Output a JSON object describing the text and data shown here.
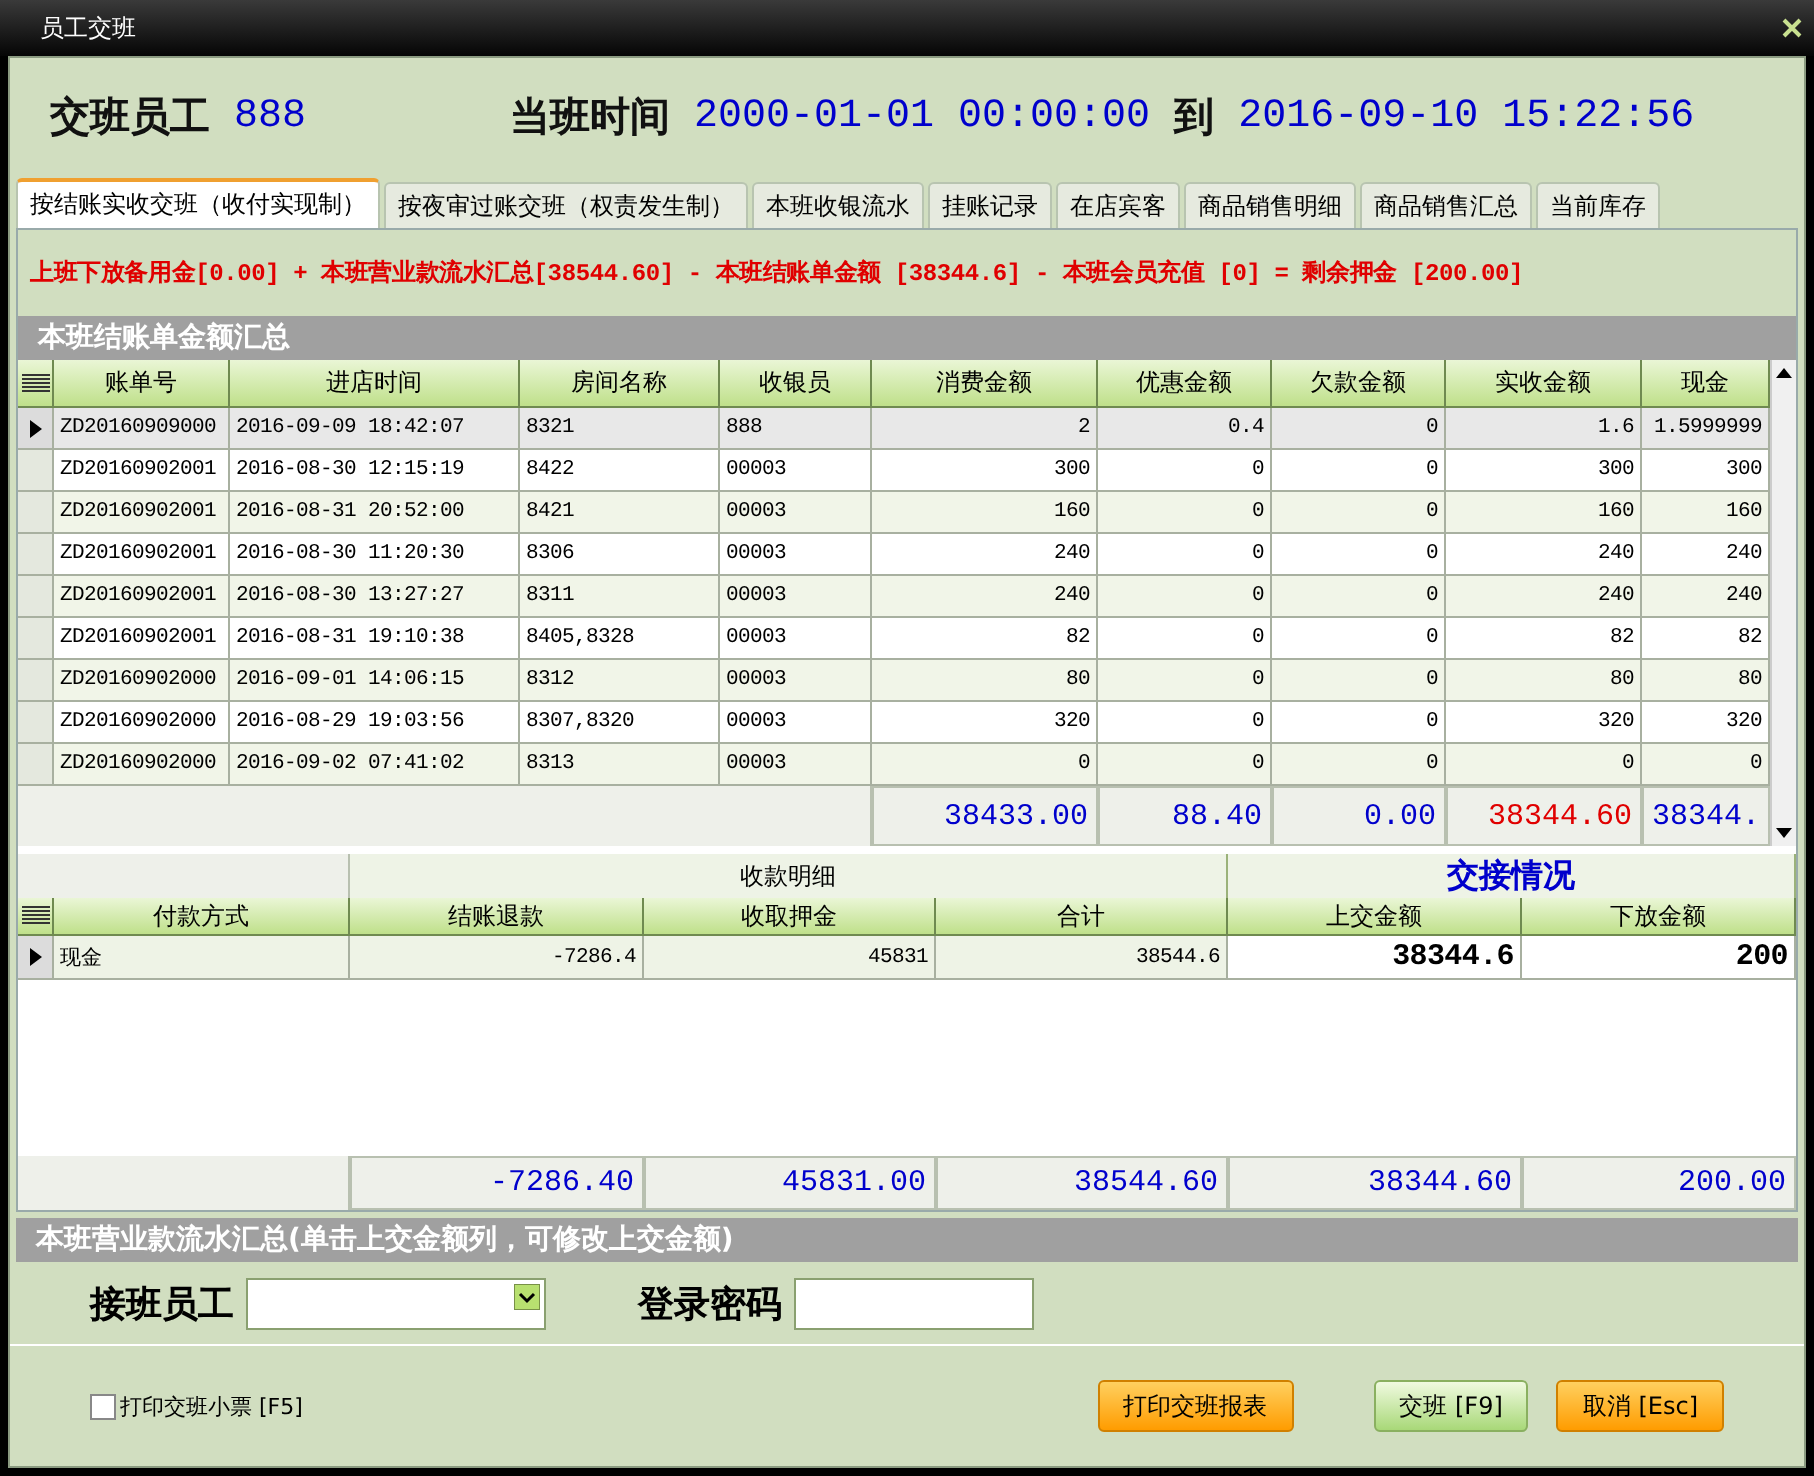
{
  "window": {
    "title": "员工交班"
  },
  "header": {
    "employee_label": "交班员工",
    "employee": "888",
    "shift_label": "当班时间",
    "start": "2000-01-01 00:00:00",
    "to": "到",
    "end": "2016-09-10 15:22:56"
  },
  "tabs": [
    {
      "label": "按结账实收交班（收付实现制）",
      "selected": true
    },
    {
      "label": "按夜审过账交班（权责发生制）",
      "selected": false
    },
    {
      "label": "本班收银流水",
      "selected": false
    },
    {
      "label": "挂账记录",
      "selected": false
    },
    {
      "label": "在店宾客",
      "selected": false
    },
    {
      "label": "商品销售明细",
      "selected": false
    },
    {
      "label": "商品销售汇总",
      "selected": false
    },
    {
      "label": "当前库存",
      "selected": false
    }
  ],
  "formula": "上班下放备用金[0.00] + 本班营业款流水汇总[38544.60] - 本班结账单金额 [38344.6] - 本班会员充值 [0] = 剩余押金 [200.00]",
  "bills": {
    "title": "本班结账单金额汇总",
    "columns": [
      "账单号",
      "进店时间",
      "房间名称",
      "收银员",
      "消费金额",
      "优惠金额",
      "欠款金额",
      "实收金额",
      "现金"
    ],
    "rows": [
      {
        "selected": true,
        "cells": [
          "ZD20160909000",
          "2016-09-09 18:42:07",
          "8321",
          "888",
          "2",
          "0.4",
          "0",
          "1.6",
          "1.5999999"
        ]
      },
      {
        "selected": false,
        "cells": [
          "ZD20160902001",
          "2016-08-30 12:15:19",
          "8422",
          "00003",
          "300",
          "0",
          "0",
          "300",
          "300"
        ]
      },
      {
        "selected": false,
        "cells": [
          "ZD20160902001",
          "2016-08-31 20:52:00",
          "8421",
          "00003",
          "160",
          "0",
          "0",
          "160",
          "160"
        ]
      },
      {
        "selected": false,
        "cells": [
          "ZD20160902001",
          "2016-08-30 11:20:30",
          "8306",
          "00003",
          "240",
          "0",
          "0",
          "240",
          "240"
        ]
      },
      {
        "selected": false,
        "cells": [
          "ZD20160902001",
          "2016-08-30 13:27:27",
          "8311",
          "00003",
          "240",
          "0",
          "0",
          "240",
          "240"
        ]
      },
      {
        "selected": false,
        "cells": [
          "ZD20160902001",
          "2016-08-31 19:10:38",
          "8405,8328",
          "00003",
          "82",
          "0",
          "0",
          "82",
          "82"
        ]
      },
      {
        "selected": false,
        "cells": [
          "ZD20160902000",
          "2016-09-01 14:06:15",
          "8312",
          "00003",
          "80",
          "0",
          "0",
          "80",
          "80"
        ]
      },
      {
        "selected": false,
        "cells": [
          "ZD20160902000",
          "2016-08-29 19:03:56",
          "8307,8320",
          "00003",
          "320",
          "0",
          "0",
          "320",
          "320"
        ]
      },
      {
        "selected": false,
        "cells": [
          "ZD20160902000",
          "2016-09-02 07:41:02",
          "8313",
          "00003",
          "0",
          "0",
          "0",
          "0",
          "0"
        ]
      }
    ],
    "totals": [
      {
        "text": "38433.00",
        "color": "#0000cc"
      },
      {
        "text": "88.40",
        "color": "#0000cc"
      },
      {
        "text": "0.00",
        "color": "#0000cc"
      },
      {
        "text": "38344.60",
        "color": "#e00000"
      },
      {
        "text": "38344.",
        "color": "#0000cc"
      }
    ]
  },
  "payments": {
    "groups": [
      {
        "columns": [
          "付款方式"
        ]
      },
      {
        "label": "收款明细",
        "columns": [
          "结账退款",
          "收取押金",
          "合计"
        ],
        "kind": "plain"
      },
      {
        "label": "交接情况",
        "columns": [
          "上交金额",
          "下放金额"
        ],
        "kind": "highlight"
      }
    ],
    "rows": [
      {
        "selected": true,
        "cells": [
          {
            "text": "现金",
            "bold": false
          },
          {
            "text": "-7286.4",
            "bold": false
          },
          {
            "text": "45831",
            "bold": false
          },
          {
            "text": "38544.6",
            "bold": false
          },
          {
            "text": "38344.6",
            "bold": true
          },
          {
            "text": "200",
            "bold": true
          }
        ]
      }
    ],
    "totals": [
      "-7286.40",
      "45831.00",
      "38544.60",
      "38344.60",
      "200.00"
    ]
  },
  "summary_title": "本班营业款流水汇总(单击上交金额列，可修改上交金额)",
  "handover": {
    "employee_label": "接班员工",
    "password_label": "登录密码"
  },
  "print_ticket": {
    "label": "打印交班小票 [F5]",
    "checked": false
  },
  "buttons": [
    {
      "label": "打印交班报表",
      "kind": "orange"
    },
    {
      "label": "交班 [F9]",
      "kind": "green"
    },
    {
      "label": "取消 [Esc]",
      "kind": "orange"
    }
  ]
}
